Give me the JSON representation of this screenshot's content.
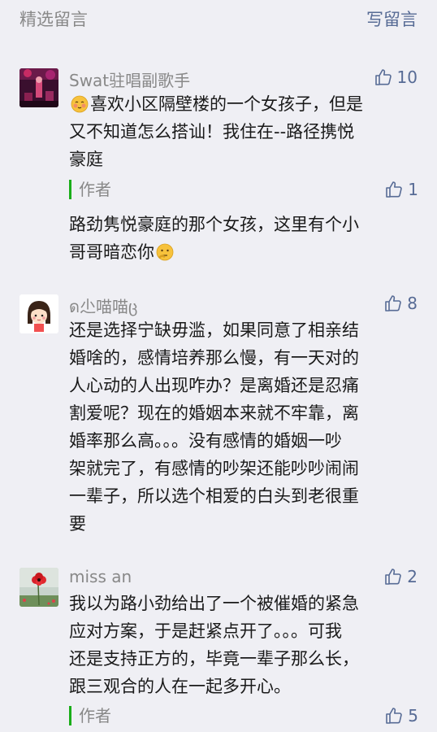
{
  "header": {
    "title": "精选留言",
    "write_label": "写留言"
  },
  "comments": [
    {
      "nickname": "Swat驻唱副歌手",
      "likes": "10",
      "avatar_icon": "concert-stage-photo",
      "emoji_icon": "shy-blush-emoji",
      "text_line1": "喜欢小区隔壁楼的一个女孩子，但是",
      "text_line2": "又不知道怎么搭讪！我住在--路径携悦",
      "text_line3": "豪庭",
      "reply": {
        "author": "作者",
        "likes": "1",
        "line1": "路劲隽悦豪庭的那个女孩，这里有个小",
        "line2": "哥哥暗恋你",
        "emoji_icon": "thinking-emoji"
      }
    },
    {
      "nickname": "ด尐喵喵ც",
      "likes": "8",
      "avatar_icon": "cartoon-girl-avatar",
      "lines": [
        "还是选择宁缺毋滥，如果同意了相亲结",
        "婚啥的，感情培养那么慢，有一天对的",
        "人心动的人出现咋办？是离婚还是忍痛",
        "割爱呢？现在的婚姻本来就不牢靠，离",
        "婚率那么高。。。没有感情的婚姻一吵",
        "架就完了，有感情的吵架还能吵吵闹闹",
        "一辈子，所以选个相爱的白头到老很重",
        "要"
      ]
    },
    {
      "nickname": "miss an",
      "likes": "2",
      "avatar_icon": "red-flower-photo",
      "lines": [
        "我以为路小劲给出了一个被催婚的紧急",
        "应对方案，于是赶紧点开了。。。可我",
        "还是支持正方的，毕竟一辈子那么长，",
        "跟三观合的人在一起多开心。"
      ],
      "reply": {
        "author": "作者",
        "likes": "5"
      }
    }
  ],
  "colors": {
    "link": "#576b95",
    "author_bar": "#1aad19",
    "meta_text": "#888888",
    "background": "#efeff4"
  }
}
